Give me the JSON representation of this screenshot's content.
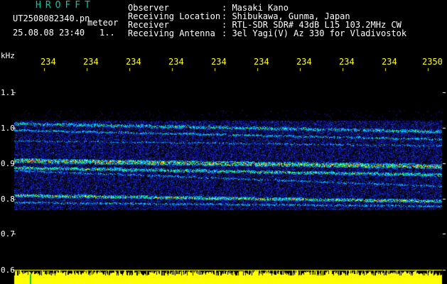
{
  "app": {
    "title": "HROFFT",
    "filename": "UT2508082340.pn",
    "mode": "meteor",
    "datetime": "25.08.08 23:40",
    "page": "1.."
  },
  "header": {
    "rows": [
      {
        "label": "Observer",
        "value": ": Masaki Kano"
      },
      {
        "label": "Receiving Location",
        "value": ": Shibukawa, Gunma, Japan"
      },
      {
        "label": "Receiver",
        "value": ": RTL-SDR SDR# 43dB L15 103.2MHz CW"
      },
      {
        "label": "Receiving Antenna",
        "value": ": 3el Yagi(V) Az 330 for Vladivostok"
      }
    ]
  },
  "y_axis": {
    "unit": "kHz",
    "ticks": [
      "1.1",
      "1.0",
      "0.9",
      "0.8",
      "0.7",
      "0.6"
    ]
  },
  "time_axis": {
    "labels": [
      "234",
      "234",
      "234",
      "234",
      "234",
      "234",
      "234",
      "234",
      "234",
      "2350"
    ]
  },
  "colors": {
    "background": "#000000",
    "spectrum_noise": "#1a1aa0",
    "signal_mid": "#00b0ff",
    "signal_strong": "#ffff00",
    "signal_peak": "#ff2000",
    "baseline": "#ffff00",
    "tick_label": "#ffff00"
  }
}
